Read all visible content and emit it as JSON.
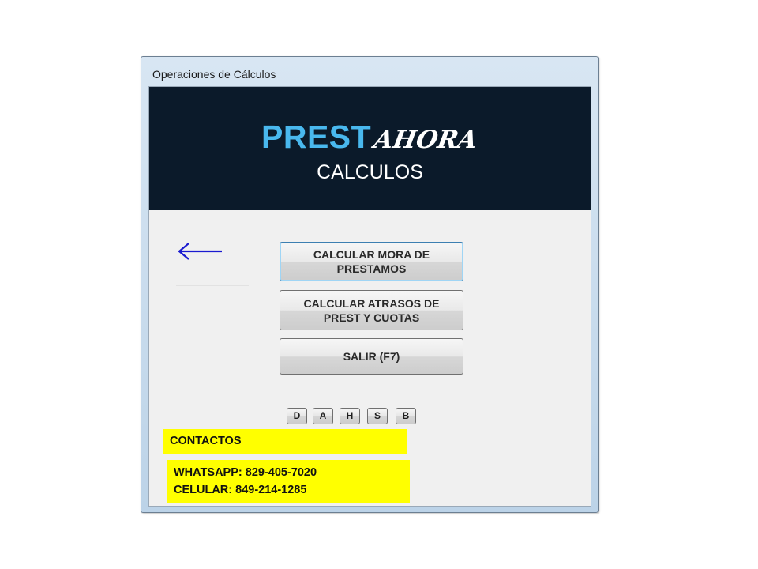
{
  "window": {
    "title": "Operaciones de Cálculos"
  },
  "banner": {
    "brand_main": "PREST",
    "brand_accent": "AHORA",
    "subtitle": "CALCULOS",
    "colors": {
      "background": "#0b1a2a",
      "brand_main": "#49b8ee",
      "brand_accent": "#ffffff"
    }
  },
  "back_arrow": {
    "icon": "arrow-left-icon",
    "color": "#1a1ad0"
  },
  "buttons": {
    "mora": {
      "line1": "CALCULAR MORA DE",
      "line2": "PRESTAMOS"
    },
    "atrasos": {
      "line1": "CALCULAR ATRASOS DE",
      "line2": "PREST Y CUOTAS"
    },
    "salir": {
      "label": "SALIR (F7)"
    }
  },
  "mini_buttons": [
    "D",
    "A",
    "H",
    "S",
    "B"
  ],
  "contacts": {
    "heading": "CONTACTOS",
    "whatsapp": "WHATSAPP: 829-405-7020",
    "celular": "CELULAR: 849-214-1285",
    "highlight_color": "#ffff00"
  }
}
